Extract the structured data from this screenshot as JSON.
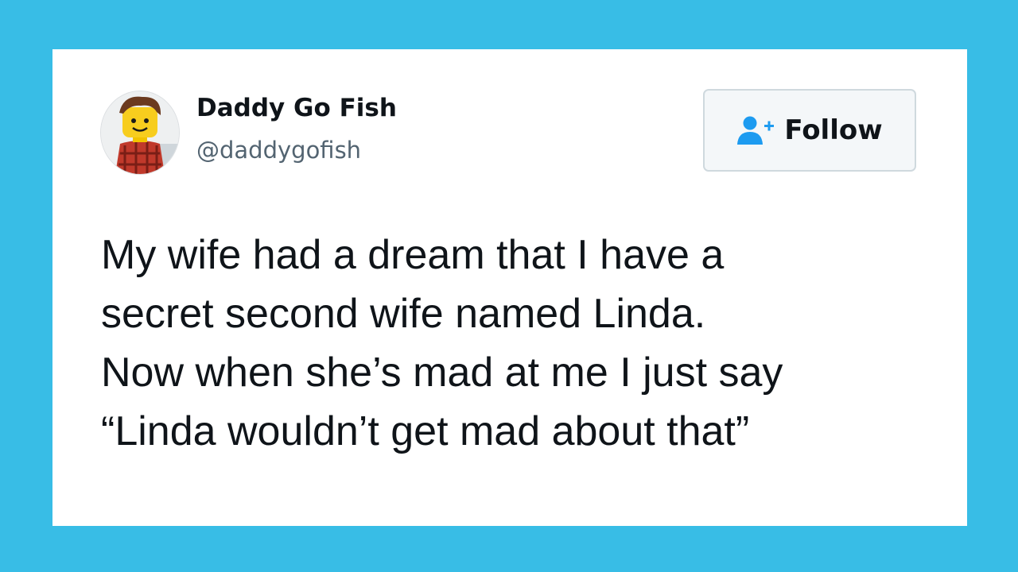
{
  "colors": {
    "frame_background": "#38bde6",
    "card_background": "#ffffff",
    "follow_icon": "#1d9bf0",
    "text_primary": "#0f1419",
    "text_secondary": "#536471"
  },
  "tweet": {
    "author": {
      "display_name": "Daddy Go Fish",
      "handle": "@daddygofish",
      "avatar_icon": "lego-minifigure-avatar"
    },
    "follow_button": {
      "label": "Follow",
      "icon": "add-user-icon"
    },
    "text_lines": [
      "My wife had a dream that I have a",
      "secret second wife named Linda.",
      "Now when she’s mad at me I just say",
      "“Linda wouldn’t get mad about that”"
    ]
  }
}
